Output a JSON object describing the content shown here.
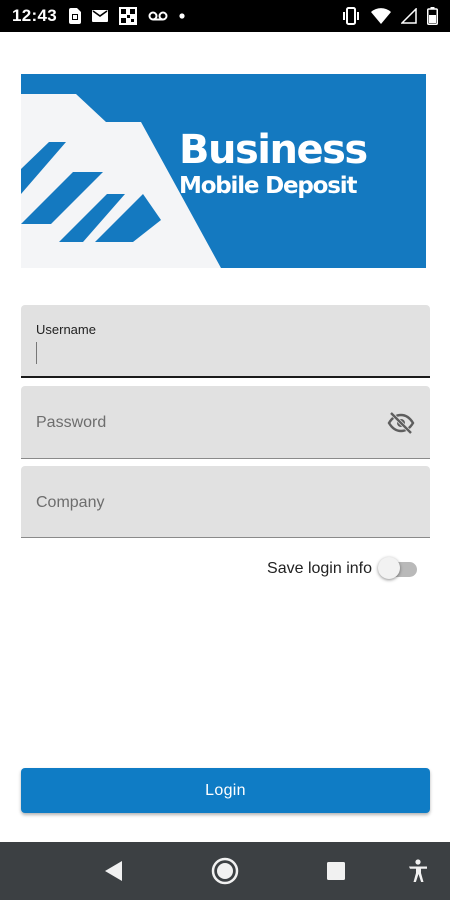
{
  "status_bar": {
    "time": "12:43",
    "left_icons": [
      "sim-card-icon",
      "mail-icon",
      "qr-icon",
      "voicemail-icon",
      "dot-icon"
    ],
    "right_icons": [
      "vibrate-icon",
      "wifi-icon",
      "signal-icon",
      "battery-icon"
    ]
  },
  "banner": {
    "title": "Business",
    "subtitle": "Mobile Deposit",
    "brand_color": "#1479c0"
  },
  "form": {
    "username": {
      "label": "Username",
      "value": ""
    },
    "password": {
      "placeholder": "Password",
      "value": "",
      "visibility_icon": "eye-off-icon"
    },
    "company": {
      "placeholder": "Company",
      "value": ""
    },
    "save_login": {
      "label": "Save login info",
      "enabled": false
    }
  },
  "login_button": {
    "label": "Login",
    "color": "#0f7cc5"
  },
  "nav_bar": {
    "buttons": [
      "back-icon",
      "home-icon",
      "recents-icon",
      "accessibility-icon"
    ]
  }
}
